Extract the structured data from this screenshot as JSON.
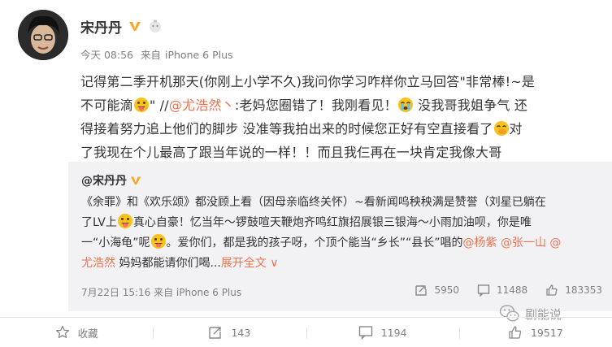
{
  "post": {
    "author": "宋丹丹",
    "meta": {
      "time": "今天 08:56",
      "source_prefix": "来自",
      "source": "iPhone 6 Plus"
    },
    "text": {
      "line1": "记得第二季开机那天(你刚上小学不久)我问你学习咋样你立马回答\"非常棒!~是",
      "line2_a": "不可能滴",
      "line2_b": "\" //",
      "line2_mention": "@尤浩然丶",
      "line2_c": ":老妈您圈错了！我刚看见！",
      "line2_d": " 没我哥我姐争气 还",
      "line3_a": "得接着努力追上他们的脚步 没准等我拍出来的时候您正好有空直接看了",
      "line3_b": "对",
      "line4": "了我现在个儿最高了跟当年说的一样！！而且我仨再在一块肯定我像大哥"
    }
  },
  "retweet": {
    "author": "@宋丹丹",
    "text": {
      "p1": "《余罪》和《欢乐颂》都没顾上看（因母亲临终关怀）~看新闻呜秧秧满是赞誉（刘星已躺在",
      "p2": "了LV上",
      "p3": "真心自豪！忆当年～锣鼓喧天鞭炮齐鸣红旗招展银三银海～小雨加油呗，你是唯",
      "p4": "一“小海龟”呢",
      "p5": "。爱你们，都是我的孩子呀，个顶个能当“乡长”“县长”唱的",
      "m1": "@杨紫",
      "m2": " @张一山",
      "m3": " @",
      "m4": "尤浩然",
      "p6": " 妈妈都能请你们喝...",
      "expand": "展开全文 ∨"
    },
    "meta": "7月22日 15:16 来自 iPhone 6 Plus",
    "stats": {
      "reposts": "5950",
      "comments": "11488",
      "likes": "183353"
    }
  },
  "watermark": "剧能说",
  "actions": {
    "favorite": "收藏",
    "repost": "143",
    "comment": "1194",
    "like": "19517"
  },
  "colors": {
    "mention": "#eb7350",
    "vip": "#f5a623",
    "meta": "#808080",
    "retweet_bg": "#f2f2f5"
  }
}
